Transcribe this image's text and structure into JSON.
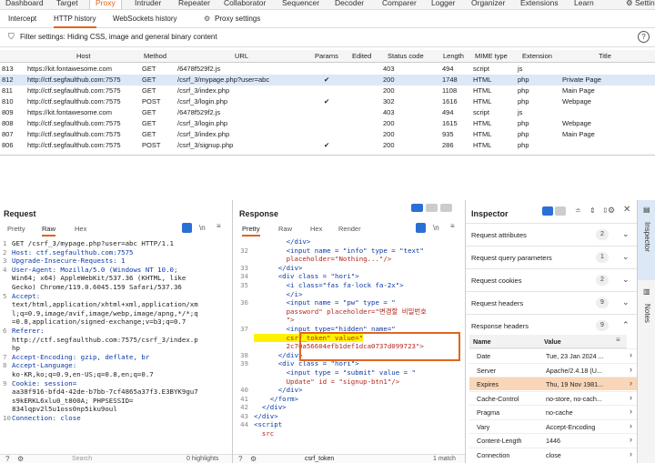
{
  "top_nav": [
    "Dashboard",
    "Target",
    "Proxy",
    "Intruder",
    "Repeater",
    "Collaborator",
    "Sequencer",
    "Decoder",
    "Comparer",
    "Logger",
    "Organizer",
    "Extensions",
    "Learn",
    "Settings"
  ],
  "active_top": "Proxy",
  "sub_tabs": {
    "intercept": "Intercept",
    "http_history": "HTTP history",
    "websockets": "WebSockets history",
    "proxy_settings": "Proxy settings"
  },
  "filter_text": "Filter settings: Hiding CSS, image and general binary content",
  "columns": [
    "Host",
    "Method",
    "URL",
    "Params",
    "Edited",
    "Status code",
    "Length",
    "MIME type",
    "Extension",
    "Title"
  ],
  "rows": [
    {
      "id": "813",
      "host": "https://kit.fontawesome.com",
      "method": "GET",
      "url": "/6478f529f2.js",
      "params": "",
      "edited": "",
      "status": "403",
      "length": "494",
      "mime": "script",
      "ext": "js",
      "title": "",
      "selected": false
    },
    {
      "id": "812",
      "host": "http://ctf.segfaulthub.com:7575",
      "method": "GET",
      "url": "/csrf_3/mypage.php?user=abc",
      "params": "✔",
      "edited": "",
      "status": "200",
      "length": "1748",
      "mime": "HTML",
      "ext": "php",
      "title": "Private Page",
      "selected": true
    },
    {
      "id": "811",
      "host": "http://ctf.segfaulthub.com:7575",
      "method": "GET",
      "url": "/csrf_3/index.php",
      "params": "",
      "edited": "",
      "status": "200",
      "length": "1108",
      "mime": "HTML",
      "ext": "php",
      "title": "Main Page",
      "selected": false
    },
    {
      "id": "810",
      "host": "http://ctf.segfaulthub.com:7575",
      "method": "POST",
      "url": "/csrf_3/login.php",
      "params": "✔",
      "edited": "",
      "status": "302",
      "length": "1616",
      "mime": "HTML",
      "ext": "php",
      "title": "Webpage",
      "selected": false
    },
    {
      "id": "809",
      "host": "https://kit.fontawesome.com",
      "method": "GET",
      "url": "/6478f529f2.js",
      "params": "",
      "edited": "",
      "status": "403",
      "length": "494",
      "mime": "script",
      "ext": "js",
      "title": "",
      "selected": false
    },
    {
      "id": "808",
      "host": "http://ctf.segfaulthub.com:7575",
      "method": "GET",
      "url": "/csrf_3/login.php",
      "params": "",
      "edited": "",
      "status": "200",
      "length": "1615",
      "mime": "HTML",
      "ext": "php",
      "title": "Webpage",
      "selected": false
    },
    {
      "id": "807",
      "host": "http://ctf.segfaulthub.com:7575",
      "method": "GET",
      "url": "/csrf_3/index.php",
      "params": "",
      "edited": "",
      "status": "200",
      "length": "935",
      "mime": "HTML",
      "ext": "php",
      "title": "Main Page",
      "selected": false
    },
    {
      "id": "806",
      "host": "http://ctf.segfaulthub.com:7575",
      "method": "POST",
      "url": "/csrf_3/signup.php",
      "params": "✔",
      "edited": "",
      "status": "200",
      "length": "286",
      "mime": "HTML",
      "ext": "php",
      "title": "",
      "selected": false
    }
  ],
  "request": {
    "title": "Request",
    "tabs": [
      "Pretty",
      "Raw",
      "Hex"
    ],
    "active_tab": "Raw",
    "lines": [
      {
        "n": "1",
        "t": "GET /csrf_3/mypage.php?user=abc HTTP/1.1"
      },
      {
        "n": "2",
        "t": "Host: ctf.segfaulthub.com:7575"
      },
      {
        "n": "3",
        "t": "Upgrade-Insecure-Requests: 1"
      },
      {
        "n": "4",
        "t": "User-Agent: Mozilla/5.0 (Windows NT 10.0;"
      },
      {
        "n": "",
        "t": "Win64; x64) AppleWebKit/537.36 (KHTML, like"
      },
      {
        "n": "",
        "t": "Gecko) Chrome/119.0.6045.159 Safari/537.36"
      },
      {
        "n": "5",
        "t": "Accept:"
      },
      {
        "n": "",
        "t": "text/html,application/xhtml+xml,application/xm"
      },
      {
        "n": "",
        "t": "l;q=0.9,image/avif,image/webp,image/apng,*/*;q"
      },
      {
        "n": "",
        "t": "=0.8,application/signed-exchange;v=b3;q=0.7"
      },
      {
        "n": "6",
        "t": "Referer:"
      },
      {
        "n": "",
        "t": "http://ctf.segfaulthub.com:7575/csrf_3/index.p"
      },
      {
        "n": "",
        "t": "hp"
      },
      {
        "n": "7",
        "t": "Accept-Encoding: gzip, deflate, br"
      },
      {
        "n": "8",
        "t": "Accept-Language:"
      },
      {
        "n": "",
        "t": "ko-KR,ko;q=0.9,en-US;q=0.8,en;q=0.7"
      },
      {
        "n": "9",
        "t": "Cookie: session="
      },
      {
        "n": "",
        "t": "aa38f916-bfd4-42de-b7bb-7cf4865a37f3.E3BYK9gu7"
      },
      {
        "n": "",
        "t": "s9kERKL6xlu0_t800A; PHPSESSID="
      },
      {
        "n": "",
        "t": "834lqpv2l5u1oss0np5iku9oul"
      },
      {
        "n": "10",
        "t": "Connection: close"
      }
    ],
    "search_placeholder": "Search",
    "highlights": "0 highlights"
  },
  "response": {
    "title": "Response",
    "tabs": [
      "Pretty",
      "Raw",
      "Hex",
      "Render"
    ],
    "active_tab": "Pretty",
    "lines": [
      {
        "n": "",
        "t": "        </div>"
      },
      {
        "n": "32",
        "t": "        <input name = \"info\" type = \"text\""
      },
      {
        "n": "",
        "t": "        placeholder=\"Nothing...\"/>"
      },
      {
        "n": "33",
        "t": "      </div>"
      },
      {
        "n": "34",
        "t": "      <div class = \"hori\">"
      },
      {
        "n": "35",
        "t": "        <i class=\"fas fa-lock fa-2x\">"
      },
      {
        "n": "",
        "t": "        </i>"
      },
      {
        "n": "36",
        "t": "        <input name = \"pw\" type = \""
      },
      {
        "n": "",
        "t": "        password\" placeholder=\"변경할 비밀번호"
      },
      {
        "n": "",
        "t": "        \">"
      },
      {
        "n": "37",
        "t": "        <input type=\"hidden\" name=\""
      },
      {
        "n": "",
        "t": "        csrf_token\" value=\""
      },
      {
        "n": "",
        "t": "        2c70a56604efb1def1dca0737d099723\">"
      },
      {
        "n": "38",
        "t": "      </div>"
      },
      {
        "n": "39",
        "t": "      <div class = \"hori\">"
      },
      {
        "n": "",
        "t": "        <input type = \"submit\" value = \""
      },
      {
        "n": "",
        "t": "        Update\" id = \"signup-btn1\"/>"
      },
      {
        "n": "40",
        "t": "      </div>"
      },
      {
        "n": "41",
        "t": "    </form>"
      },
      {
        "n": "42",
        "t": "  </div>"
      },
      {
        "n": "43",
        "t": "</div>"
      },
      {
        "n": "44",
        "t": "<script"
      },
      {
        "n": "",
        "t": "  src"
      }
    ],
    "search_value": "csrf_token",
    "matches": "1 match"
  },
  "inspector": {
    "title": "Inspector",
    "sections": [
      {
        "label": "Request attributes",
        "count": "2",
        "chev": "⌄"
      },
      {
        "label": "Request query parameters",
        "count": "1",
        "chev": "⌄"
      },
      {
        "label": "Request cookies",
        "count": "2",
        "chev": "⌄"
      },
      {
        "label": "Request headers",
        "count": "9",
        "chev": "⌄"
      },
      {
        "label": "Response headers",
        "count": "9",
        "chev": "⌃"
      }
    ],
    "col_name": "Name",
    "col_value": "Value",
    "headers": [
      {
        "n": "Date",
        "v": "Tue, 23 Jan 2024 ...",
        "hl": false
      },
      {
        "n": "Server",
        "v": "Apache/2.4.18 (U...",
        "hl": false
      },
      {
        "n": "Expires",
        "v": "Thu, 19 Nov 1981...",
        "hl": true
      },
      {
        "n": "Cache-Control",
        "v": "no-store, no-cach...",
        "hl": false
      },
      {
        "n": "Pragma",
        "v": "no-cache",
        "hl": false
      },
      {
        "n": "Vary",
        "v": "Accept-Encoding",
        "hl": false
      },
      {
        "n": "Content-Length",
        "v": "1446",
        "hl": false
      },
      {
        "n": "Connection",
        "v": "close",
        "hl": false
      }
    ]
  },
  "side_tabs": [
    "Inspector",
    "Notes"
  ],
  "colors": {
    "accent": "#e3631a",
    "selected_row": "#dce8f8",
    "highlight": "#fff200",
    "link": "#0b3aa8"
  }
}
